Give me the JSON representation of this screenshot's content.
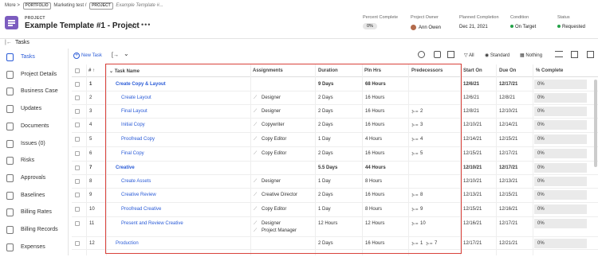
{
  "breadcrumb": {
    "more": "More",
    "sep": ">",
    "portfolio_tag": "PORTFOLIO",
    "portfolio": "Marketing test",
    "slash": "/",
    "project_tag": "PROJECT",
    "project": "Example Template #..."
  },
  "project": {
    "label": "PROJECT",
    "title": "Example Template #1 - Project",
    "star": "☆",
    "more": "•••"
  },
  "meta": {
    "percent_complete": {
      "label": "Percent Complete",
      "value": "0%"
    },
    "owner": {
      "label": "Project Owner",
      "value": "Ann Owen"
    },
    "planned_completion": {
      "label": "Planned Completion",
      "value": "Dec 21, 2021"
    },
    "condition": {
      "label": "Condition",
      "value": "On Target"
    },
    "status": {
      "label": "Status",
      "value": "Requested"
    }
  },
  "colors": {
    "accent": "#2a5bd7",
    "brand": "#7c5cbf",
    "condition": "#24a148",
    "status": "#24a148",
    "highlight": "#d9423b"
  },
  "tasks_header": {
    "back_icon": "|←",
    "label": "Tasks"
  },
  "sidebar": {
    "items": [
      {
        "label": "Tasks",
        "icon": "tasks-icon"
      },
      {
        "label": "Project Details",
        "icon": "details-icon"
      },
      {
        "label": "Business Case",
        "icon": "briefcase-icon"
      },
      {
        "label": "Updates",
        "icon": "chat-icon"
      },
      {
        "label": "Documents",
        "icon": "document-icon"
      },
      {
        "label": "Issues (0)",
        "icon": "issue-icon"
      },
      {
        "label": "Risks",
        "icon": "risk-icon"
      },
      {
        "label": "Approvals",
        "icon": "approval-icon"
      },
      {
        "label": "Baselines",
        "icon": "baseline-icon"
      },
      {
        "label": "Billing Rates",
        "icon": "billing-rates-icon"
      },
      {
        "label": "Billing Records",
        "icon": "billing-records-icon"
      },
      {
        "label": "Expenses",
        "icon": "expenses-icon"
      }
    ]
  },
  "toolbar": {
    "new_task": "New Task",
    "indent_icon": "[→",
    "chevron": "⌄",
    "filter": "All",
    "view": "Standard",
    "group": "Nothing"
  },
  "table": {
    "headers": {
      "num": "# ↑",
      "task_name": "Task Name",
      "assignments": "Assignments",
      "duration": "Duration",
      "pln_hrs": "Pln Hrs",
      "predecessors": "Predecessors",
      "start_on": "Start On",
      "due_on": "Due On",
      "pct": "% Complete"
    },
    "rows": [
      {
        "num": "1",
        "name": "Create Copy & Layout",
        "assign": "",
        "assign2": "",
        "duration": "9 Days",
        "hours": "68 Hours",
        "pred": "",
        "pred2": "",
        "start": "12/6/21",
        "due": "12/17/21",
        "pct": "0%"
      },
      {
        "num": "2",
        "name": "Create Layout",
        "assign": "Designer",
        "assign2": "",
        "duration": "2 Days",
        "hours": "16 Hours",
        "pred": "",
        "pred2": "",
        "start": "12/6/21",
        "due": "12/8/21",
        "pct": "0%"
      },
      {
        "num": "3",
        "name": "Final Layout",
        "assign": "Designer",
        "assign2": "",
        "duration": "2 Days",
        "hours": "16 Hours",
        "pred": "2",
        "pred2": "",
        "start": "12/8/21",
        "due": "12/10/21",
        "pct": "0%"
      },
      {
        "num": "4",
        "name": "Initial Copy",
        "assign": "Copywriter",
        "assign2": "",
        "duration": "2 Days",
        "hours": "16 Hours",
        "pred": "3",
        "pred2": "",
        "start": "12/10/21",
        "due": "12/14/21",
        "pct": "0%"
      },
      {
        "num": "5",
        "name": "Proofread Copy",
        "assign": "Copy Editor",
        "assign2": "",
        "duration": "1 Day",
        "hours": "4 Hours",
        "pred": "4",
        "pred2": "",
        "start": "12/14/21",
        "due": "12/15/21",
        "pct": "0%"
      },
      {
        "num": "6",
        "name": "Final Copy",
        "assign": "Copy Editor",
        "assign2": "",
        "duration": "2 Days",
        "hours": "16 Hours",
        "pred": "5",
        "pred2": "",
        "start": "12/15/21",
        "due": "12/17/21",
        "pct": "0%"
      },
      {
        "num": "7",
        "name": "Creative",
        "assign": "",
        "assign2": "",
        "duration": "5.5 Days",
        "hours": "44 Hours",
        "pred": "",
        "pred2": "",
        "start": "12/10/21",
        "due": "12/17/21",
        "pct": "0%"
      },
      {
        "num": "8",
        "name": "Create Assets",
        "assign": "Designer",
        "assign2": "",
        "duration": "1 Day",
        "hours": "8 Hours",
        "pred": "",
        "pred2": "",
        "start": "12/10/21",
        "due": "12/13/21",
        "pct": "0%"
      },
      {
        "num": "9",
        "name": "Creative Review",
        "assign": "Creative Director",
        "assign2": "",
        "duration": "2 Days",
        "hours": "16 Hours",
        "pred": "8",
        "pred2": "",
        "start": "12/13/21",
        "due": "12/15/21",
        "pct": "0%"
      },
      {
        "num": "10",
        "name": "Proofread Creative",
        "assign": "Copy Editor",
        "assign2": "",
        "duration": "1 Day",
        "hours": "8 Hours",
        "pred": "9",
        "pred2": "",
        "start": "12/15/21",
        "due": "12/16/21",
        "pct": "0%"
      },
      {
        "num": "11",
        "name": "Present and Review Creative",
        "assign": "Designer",
        "assign2": "Project Manager",
        "duration": "12 Hours",
        "hours": "12 Hours",
        "pred": "10",
        "pred2": "",
        "start": "12/16/21",
        "due": "12/17/21",
        "pct": "0%"
      },
      {
        "num": "12",
        "name": "Production",
        "assign": "",
        "assign2": "",
        "duration": "2 Days",
        "hours": "16 Hours",
        "pred": "1",
        "pred2": "7",
        "start": "12/17/21",
        "due": "12/21/21",
        "pct": "0%"
      }
    ]
  }
}
